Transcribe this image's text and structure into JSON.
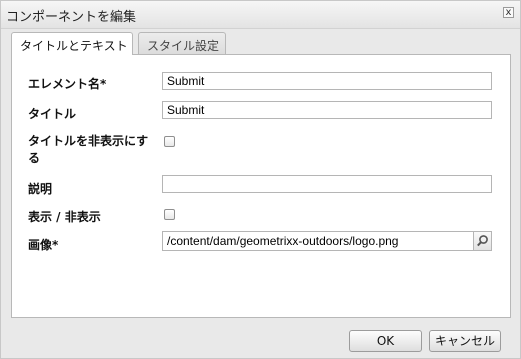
{
  "dialog": {
    "title": "コンポーネントを編集",
    "close_glyph": "x"
  },
  "tabs": [
    {
      "label": "タイトルとテキスト",
      "active": true
    },
    {
      "label": "スタイル設定",
      "active": false
    }
  ],
  "form": {
    "element_name_label": "エレメント名*",
    "element_name_value": "Submit",
    "title_label": "タイトル",
    "title_value": "Submit",
    "hide_title_label": "タイトルを非表示にする",
    "hide_title_checked": false,
    "description_label": "説明",
    "description_value": "",
    "show_hide_label": "表示 / 非表示",
    "show_hide_checked": false,
    "image_label": "画像*",
    "image_value": "/content/dam/geometrixx-outdoors/logo.png",
    "image_search_icon": "search-icon"
  },
  "footer": {
    "ok_label": "OK",
    "cancel_label": "キャンセル"
  }
}
